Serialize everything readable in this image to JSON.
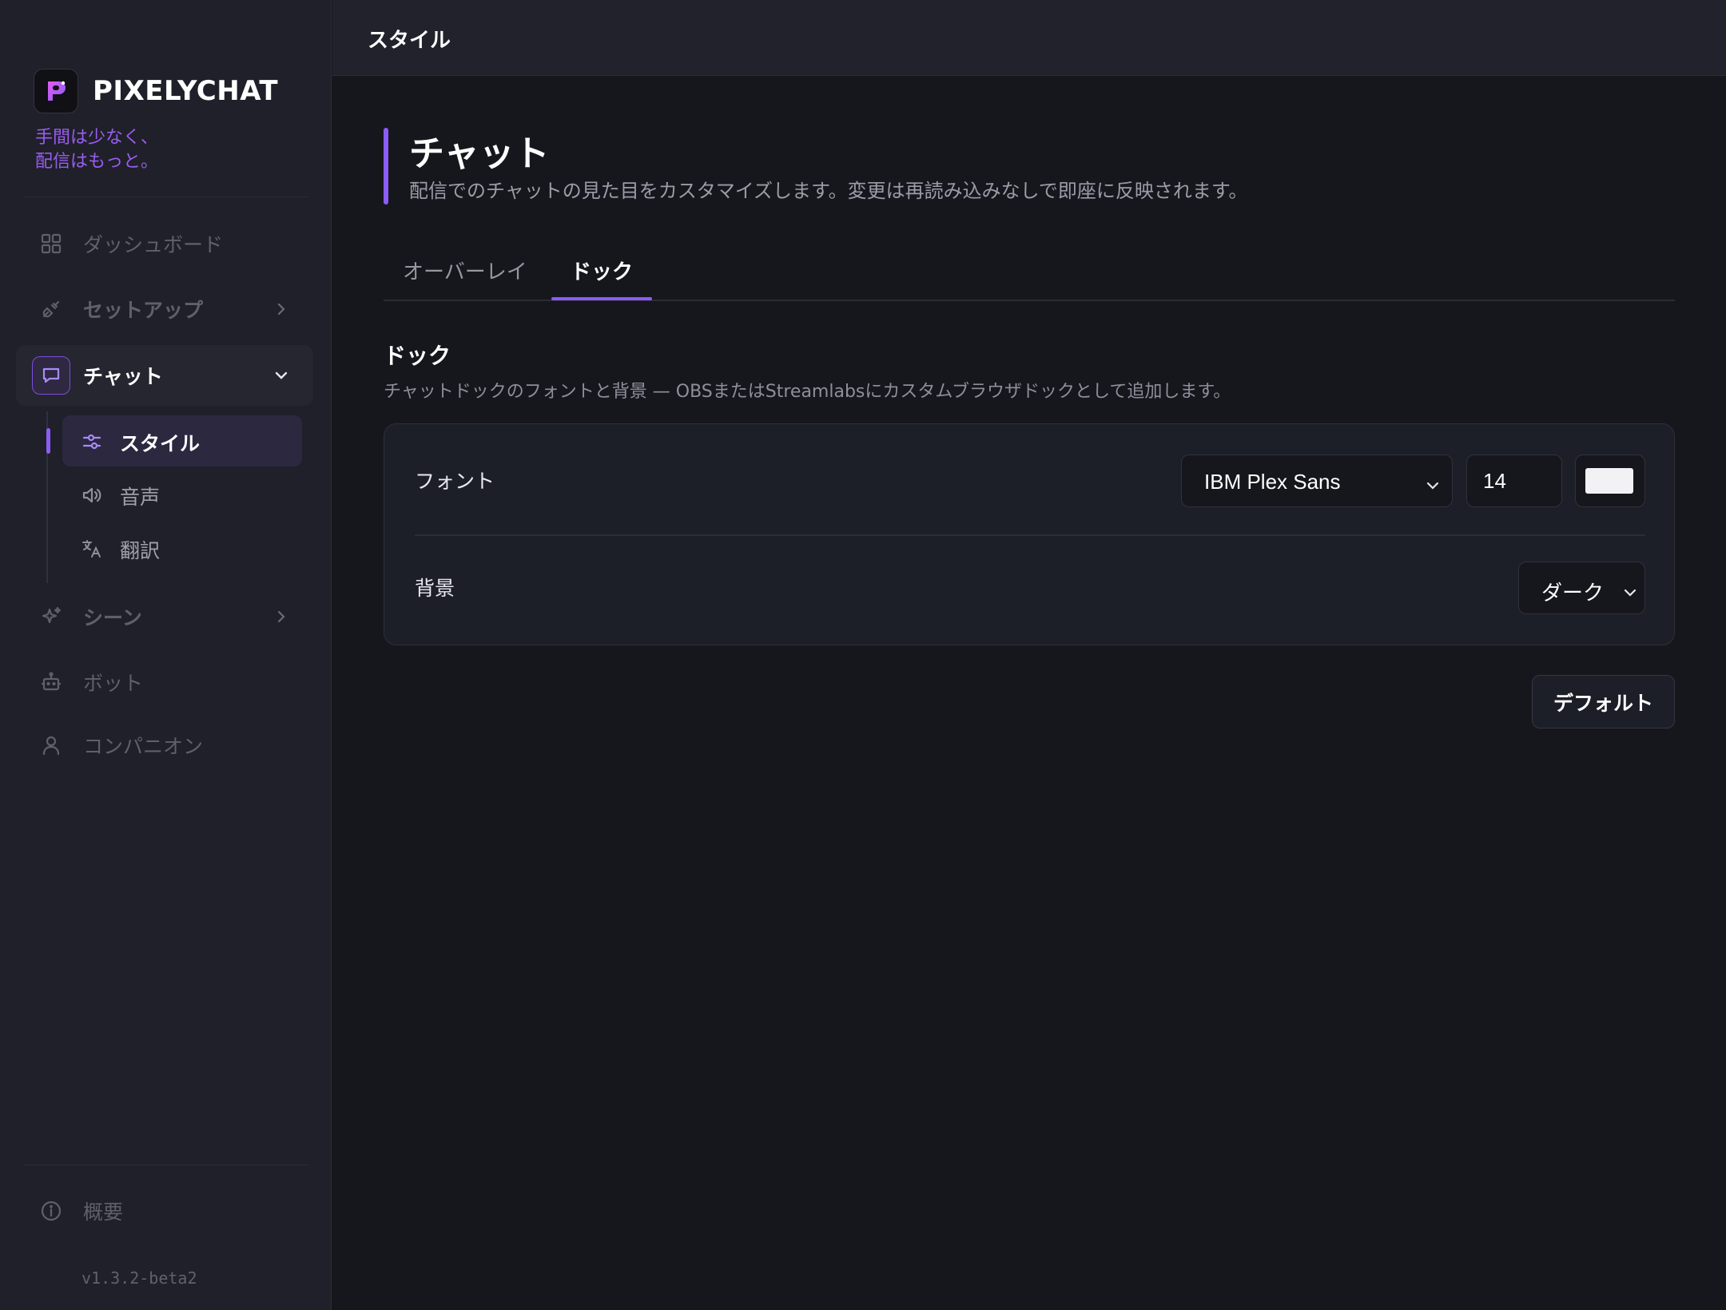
{
  "brand": {
    "name": "PIXELYCHAT",
    "tagline_line1": "手間は少なく、",
    "tagline_line2": "配信はもっと。",
    "accent_color": "#8b5cf6"
  },
  "sidebar": {
    "items": [
      {
        "label": "ダッシュボード",
        "icon": "grid-icon"
      },
      {
        "label": "セットアップ",
        "icon": "plug-icon"
      },
      {
        "label": "チャット",
        "icon": "chat-bubble-icon"
      },
      {
        "label": "シーン",
        "icon": "sparkles-icon"
      },
      {
        "label": "ボット",
        "icon": "robot-icon"
      },
      {
        "label": "コンパニオン",
        "icon": "user-icon"
      }
    ],
    "chat_sub": [
      {
        "label": "スタイル",
        "icon": "sliders-icon"
      },
      {
        "label": "音声",
        "icon": "speaker-icon"
      },
      {
        "label": "翻訳",
        "icon": "translate-icon"
      }
    ],
    "about": {
      "label": "概要",
      "icon": "info-icon"
    },
    "version": "v1.3.2-beta2"
  },
  "topbar": {
    "title": "スタイル"
  },
  "page": {
    "title": "チャット",
    "description": "配信でのチャットの見た目をカスタマイズします。変更は再読み込みなしで即座に反映されます。"
  },
  "tabs": {
    "overlay": "オーバーレイ",
    "dock": "ドック"
  },
  "section": {
    "title": "ドック",
    "description": "チャットドックのフォントと背景 — OBSまたはStreamlabsにカスタムブラウザドックとして追加します。"
  },
  "settings": {
    "font_label": "フォント",
    "font_family": "IBM Plex Sans",
    "font_size": "14",
    "font_color": "#f2f2f5",
    "background_label": "背景",
    "background_value": "ダーク"
  },
  "buttons": {
    "default": "デフォルト"
  }
}
